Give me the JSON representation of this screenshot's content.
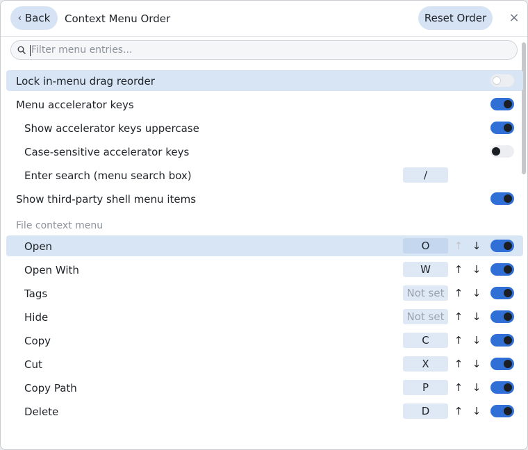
{
  "header": {
    "back_label": "Back",
    "back_chevron": "‹",
    "title": "Context Menu Order",
    "reset_label": "Reset Order",
    "close_glyph": "×"
  },
  "search": {
    "placeholder": "Filter menu entries...",
    "value": ""
  },
  "settings": [
    {
      "label": "Lock in-menu drag reorder",
      "toggle": "off",
      "highlighted": true
    },
    {
      "label": "Menu accelerator keys",
      "toggle": "on"
    },
    {
      "label": "Show accelerator keys uppercase",
      "toggle": "on"
    },
    {
      "label": "Case-sensitive accelerator keys",
      "toggle": "off-dark"
    },
    {
      "label": "Enter search (menu search box)",
      "key": "/"
    },
    {
      "label": "Show third-party shell menu items",
      "toggle": "on"
    }
  ],
  "file_section": {
    "title": "File context menu",
    "up_glyph": "↑",
    "down_glyph": "↓",
    "items": [
      {
        "label": "Open",
        "key": "O",
        "enabled": true,
        "selected": true,
        "up_disabled": true
      },
      {
        "label": "Open With",
        "key": "W",
        "enabled": true
      },
      {
        "label": "Tags",
        "key": "Not set",
        "enabled": true,
        "key_unset": true
      },
      {
        "label": "Hide",
        "key": "Not set",
        "enabled": true,
        "key_unset": true
      },
      {
        "label": "Copy",
        "key": "C",
        "enabled": true
      },
      {
        "label": "Cut",
        "key": "X",
        "enabled": true
      },
      {
        "label": "Copy Path",
        "key": "P",
        "enabled": true
      },
      {
        "label": "Delete",
        "key": "D",
        "enabled": true
      }
    ]
  },
  "colors": {
    "accent": "#2f6fd6",
    "highlight_row": "#d8e5f5",
    "pill_button": "#d5e3f4"
  }
}
